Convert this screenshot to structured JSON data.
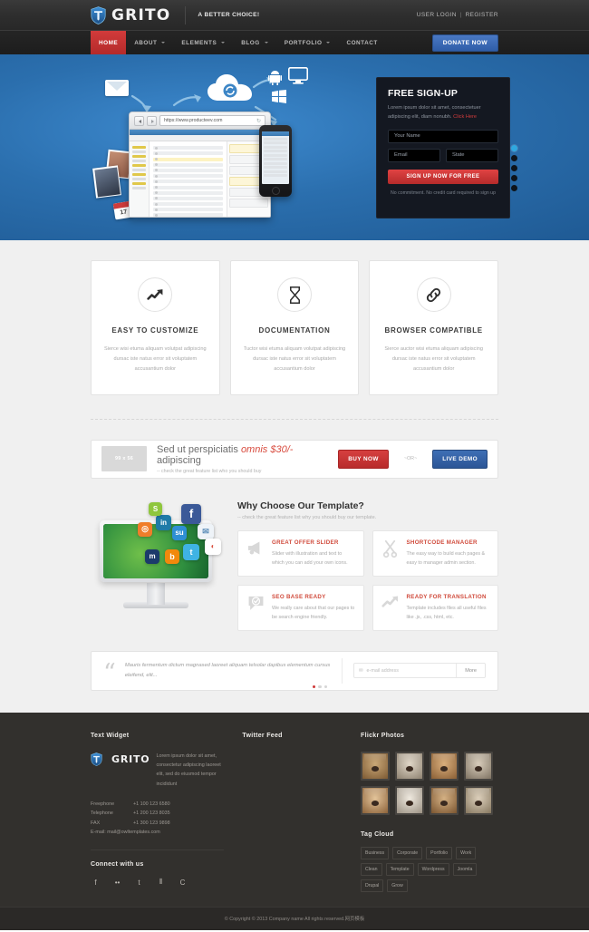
{
  "topbar": {
    "logo_text": "GRITO",
    "logo_icon": "shield-logo-icon",
    "tagline": "A BETTER CHOICE!",
    "user_login": "USER LOGIN",
    "separator": "|",
    "register": "REGISTER"
  },
  "nav": {
    "items": [
      {
        "label": "HOME",
        "active": true,
        "caret": false
      },
      {
        "label": "ABOUT",
        "active": false,
        "caret": true
      },
      {
        "label": "ELEMENTS",
        "active": false,
        "caret": true
      },
      {
        "label": "BLOG",
        "active": false,
        "caret": true
      },
      {
        "label": "PORTFOLIO",
        "active": false,
        "caret": true
      },
      {
        "label": "CONTACT",
        "active": false,
        "caret": false
      }
    ],
    "donate_label": "DONATE NOW"
  },
  "hero": {
    "browser_url": "https://www.producteev.com",
    "browser_url_scheme": "https",
    "calendar_day": "17",
    "signup": {
      "title": "FREE SIGN-UP",
      "description": "Lorem ipsum dolor sit amet, consectetuer adipiscing elit, diam nonubh.",
      "link_text": "Click Here",
      "name_placeholder": "Your Name",
      "email_placeholder": "Email",
      "state_placeholder": "State",
      "button_label": "SIGN UP NOW FOR FREE",
      "note": "No commitment. No credit card required to sign up",
      "accent_color": "#2fa8e0",
      "button_color": "#d23c3c"
    },
    "slider_dots": 5,
    "slider_active_index": 0
  },
  "features": [
    {
      "icon": "trend-up-arrow-icon",
      "title": "EASY TO CUSTOMIZE",
      "description": "Sierce wisi etuma aliquam volutpat adipiscing dursac iste natus error sit voluptatem accusantium dolor"
    },
    {
      "icon": "hourglass-icon",
      "title": "DOCUMENTATION",
      "description": "Tuctor wisi etuma aliquam volutpat adipiscing dursac iste natus error sit voluptatem accusantium dolor"
    },
    {
      "icon": "link-chain-icon",
      "title": "BROWSER COMPATIBLE",
      "description": "Sierce auctor wisi etuma aliquam adipiscing dursac iste natus error sit voluptatem accusantium dolor"
    }
  ],
  "cta": {
    "thumb_label": "99 x 56",
    "heading_part1": "Sed ut perspiciatis ",
    "heading_em": "omnis $30/-",
    "heading_part2": " adipiscing",
    "subtext": "-- check the great feature list who you should buy",
    "buy_label": "BUY NOW",
    "or_label": "~OR~",
    "demo_label": "LIVE DEMO"
  },
  "why": {
    "heading": "Why Choose Our Template?",
    "subheading": "-- check the great feature list why you should buy our template.",
    "cards": [
      {
        "icon": "megaphone-icon",
        "title": "GREAT OFFER SLIDER",
        "description": "Slider with illustration and text to which you can add your own icons."
      },
      {
        "icon": "scissors-icon",
        "title": "SHORTCODE MANAGER",
        "description": "The easy way to build each pages & easy to manager admin section."
      },
      {
        "icon": "speech-bubble-check-icon",
        "title": "SEO BASE READY",
        "description": "We really care about that our pages to be search engine friendly."
      },
      {
        "icon": "trend-up-arrow-icon",
        "title": "READY FOR TRANSLATION",
        "description": "Template includes files all useful files like .js, .css, html, etc."
      }
    ]
  },
  "testimonial": {
    "quote_icon": "quote-mark-icon",
    "text": "Mauris fermentum dictum magnased laoreet aliquam telsolar dapibus elementum cursus eleifend, elit...",
    "dots": 3,
    "active_dot": 0,
    "subscribe": {
      "icon": "envelope-icon",
      "placeholder": "e-mail address",
      "button_label": "More"
    }
  },
  "footer": {
    "text_widget": {
      "heading": "Text Widget",
      "logo_text": "GRITO",
      "about": "Lorem ipsum dolor sit amet, consectetur adipiscing laoreet elit, sed do eiusmod tempor incididunt",
      "contacts": [
        {
          "key": "Freephone",
          "value": "+1 100 123 6580"
        },
        {
          "key": "Telephone",
          "value": "+1 200 123 8035"
        },
        {
          "key": "FAX",
          "value": "+1 300 123 9898"
        }
      ],
      "email_line": "E-mail: mail@owltemplates.com",
      "connect_heading": "Connect with us",
      "social": [
        "facebook-icon",
        "flickr-icon",
        "twitter-icon",
        "rss-icon",
        "dribbble-icon"
      ]
    },
    "twitter": {
      "heading": "Twitter Feed"
    },
    "flickr": {
      "heading": "Flickr Photos",
      "photo_count": 8,
      "photo_alt": "dog-thumbnail"
    },
    "tagcloud": {
      "heading": "Tag Cloud",
      "tags": [
        "Business",
        "Corporate",
        "Portfolio",
        "Work",
        "Clean",
        "Template",
        "Wordpress",
        "Joomla",
        "Drupal",
        "Grow"
      ]
    }
  },
  "copyright": {
    "text": "© Copyright © 2013 Company name All rights reserved.网页模板"
  }
}
